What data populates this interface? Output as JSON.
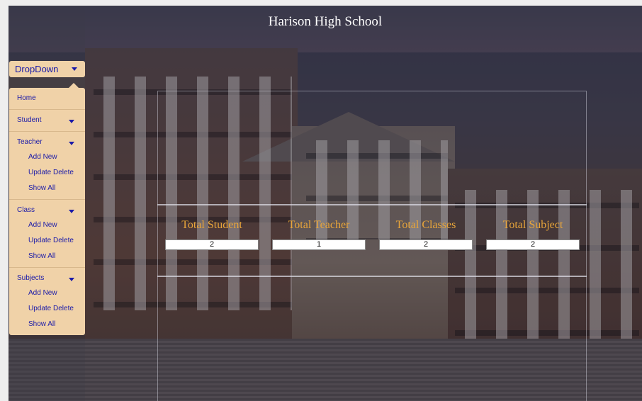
{
  "header": {
    "title": "Harison High School"
  },
  "dropdown": {
    "label": "DropDown",
    "menu": {
      "home": "Home",
      "student": "Student",
      "teacher": {
        "label": "Teacher",
        "items": [
          "Add New",
          "Update Delete",
          "Show All"
        ]
      },
      "class": {
        "label": "Class",
        "items": [
          "Add New",
          "Update Delete",
          "Show All"
        ]
      },
      "subjects": {
        "label": "Subjects",
        "items": [
          "Add New",
          "Update Delete",
          "Show All"
        ]
      }
    }
  },
  "stats": [
    {
      "label": "Total Student",
      "value": "2"
    },
    {
      "label": "Total Teacher",
      "value": "1"
    },
    {
      "label": "Total Classes",
      "value": "2"
    },
    {
      "label": "Total Subject",
      "value": "2"
    }
  ],
  "colors": {
    "menu_bg": "#f0d2a8",
    "menu_text": "#1a1aa8",
    "stat_label": "#e8a53a"
  }
}
